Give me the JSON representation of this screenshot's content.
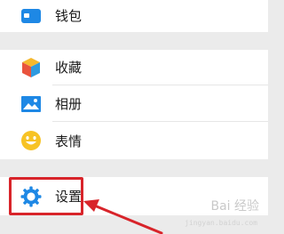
{
  "menu": {
    "wallet": {
      "label": "钱包",
      "icon": "wallet-icon"
    },
    "favorites": {
      "label": "收藏",
      "icon": "favorites-cube-icon"
    },
    "album": {
      "label": "相册",
      "icon": "album-image-icon"
    },
    "stickers": {
      "label": "表情",
      "icon": "smiley-icon"
    },
    "settings": {
      "label": "设置",
      "icon": "gear-icon"
    }
  },
  "annotation": {
    "highlight_color": "#d8242a",
    "target": "settings"
  },
  "watermark": {
    "text": "Bai 经验",
    "subtext": "jingyan.baidu.com"
  },
  "colors": {
    "background": "#ebebeb",
    "row": "#ffffff",
    "accent_blue": "#1e88e5"
  }
}
